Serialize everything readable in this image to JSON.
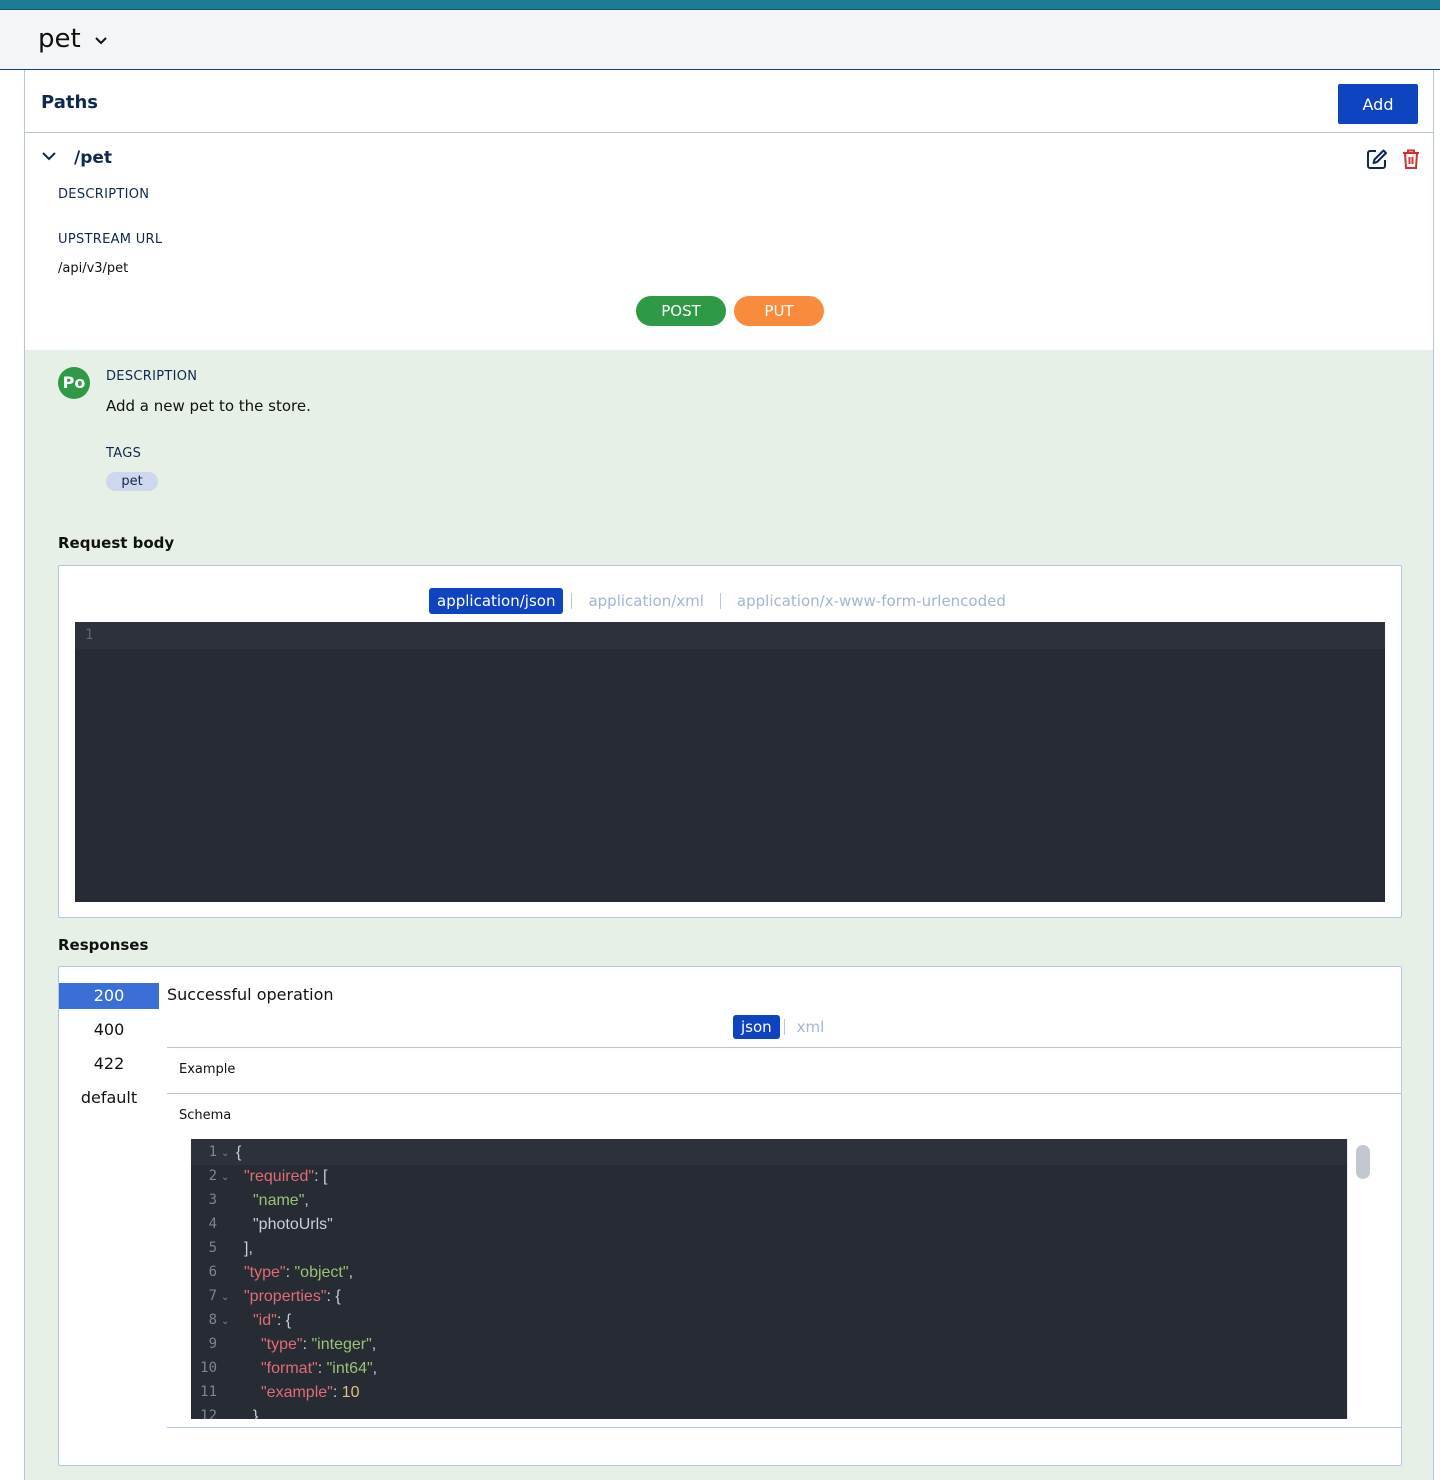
{
  "header": {
    "title": "pet"
  },
  "paths": {
    "title": "Paths",
    "add_label": "Add",
    "path": {
      "name": "/pet",
      "description_label": "DESCRIPTION",
      "upstream_label": "UPSTREAM URL",
      "upstream_url": "/api/v3/pet",
      "methods": [
        {
          "label": "POST",
          "color": "#2f9a45"
        },
        {
          "label": "PUT",
          "color": "#f98b3d"
        }
      ]
    }
  },
  "operation": {
    "avatar": "Po",
    "description_label": "DESCRIPTION",
    "description": "Add a new pet to the store.",
    "tags_label": "TAGS",
    "tags": [
      "pet"
    ]
  },
  "request_body": {
    "title": "Request body",
    "tabs": [
      "application/json",
      "application/xml",
      "application/x-www-form-urlencoded"
    ],
    "active_tab": 0,
    "editor_line": "1"
  },
  "responses": {
    "title": "Responses",
    "codes": [
      "200",
      "400",
      "422",
      "default"
    ],
    "selected": 0,
    "description": "Successful operation",
    "tabs": [
      "json",
      "xml"
    ],
    "example_label": "Example",
    "schema_label": "Schema",
    "schema_lines": [
      {
        "n": "1",
        "fold": true
      },
      {
        "n": "2",
        "fold": true
      },
      {
        "n": "3",
        "fold": false
      },
      {
        "n": "4",
        "fold": false
      },
      {
        "n": "5",
        "fold": false
      },
      {
        "n": "6",
        "fold": false
      },
      {
        "n": "7",
        "fold": true
      },
      {
        "n": "8",
        "fold": true
      },
      {
        "n": "9",
        "fold": false
      },
      {
        "n": "10",
        "fold": false
      },
      {
        "n": "11",
        "fold": false
      },
      {
        "n": "12",
        "fold": false
      }
    ],
    "schema_text": {
      "l1": "{",
      "l2k": "\"required\"",
      "l2p": ": [",
      "l3": "\"name\"",
      "l3p": ",",
      "l4": "\"photoUrls\"",
      "l5": "],",
      "l6k": "\"type\"",
      "l6c": ": ",
      "l6v": "\"object\"",
      "l6p": ",",
      "l7k": "\"properties\"",
      "l7p": ": {",
      "l8k": "\"id\"",
      "l8p": ": {",
      "l9k": "\"type\"",
      "l9c": ": ",
      "l9v": "\"integer\"",
      "l9p": ",",
      "l10k": "\"format\"",
      "l10c": ": ",
      "l10v": "\"int64\"",
      "l10p": ",",
      "l11k": "\"example\"",
      "l11c": ": ",
      "l11v": "10",
      "l12": "},"
    }
  },
  "colors": {
    "brand": "#0f44c0",
    "topbar": "#1d7c94",
    "post": "#2f9a45",
    "put": "#f98b3d",
    "danger": "#d32f2f",
    "panel": "#e6f0e6",
    "editor_bg": "#272b33"
  },
  "icons": {
    "header_chevron": "chevron-down-icon",
    "path_toggle": "chevron-down-icon",
    "edit": "edit-icon",
    "delete": "trash-icon"
  }
}
